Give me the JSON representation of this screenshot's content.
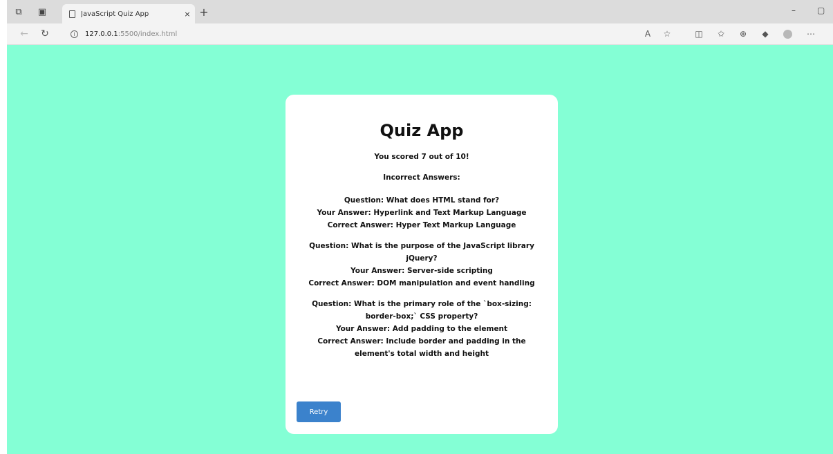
{
  "browser": {
    "tab_title": "JavaScript Quiz App",
    "tab_close": "×",
    "new_tab": "+",
    "url_host": "127.0.0.1",
    "url_path": ":5500/index.html",
    "minimize": "–",
    "restore": "▢"
  },
  "quiz": {
    "title": "Quiz App",
    "score_text": "You scored 7 out of 10!",
    "incorrect_heading": "Incorrect Answers:",
    "incorrect_answers": [
      {
        "question": "Question: What does HTML stand for?",
        "your_answer": "Your Answer: Hyperlink and Text Markup Language",
        "correct_answer": "Correct Answer: Hyper Text Markup Language"
      },
      {
        "question": "Question: What is the purpose of the JavaScript library jQuery?",
        "your_answer": "Your Answer: Server-side scripting",
        "correct_answer": "Correct Answer: DOM manipulation and event handling"
      },
      {
        "question": "Question: What is the primary role of the `box-sizing: border-box;` CSS property?",
        "your_answer": "Your Answer: Add padding to the element",
        "correct_answer": "Correct Answer: Include border and padding in the element's total width and height"
      }
    ],
    "retry_label": "Retry"
  },
  "colors": {
    "page_background": "#84ffd5",
    "retry_button": "#3b82cc"
  }
}
